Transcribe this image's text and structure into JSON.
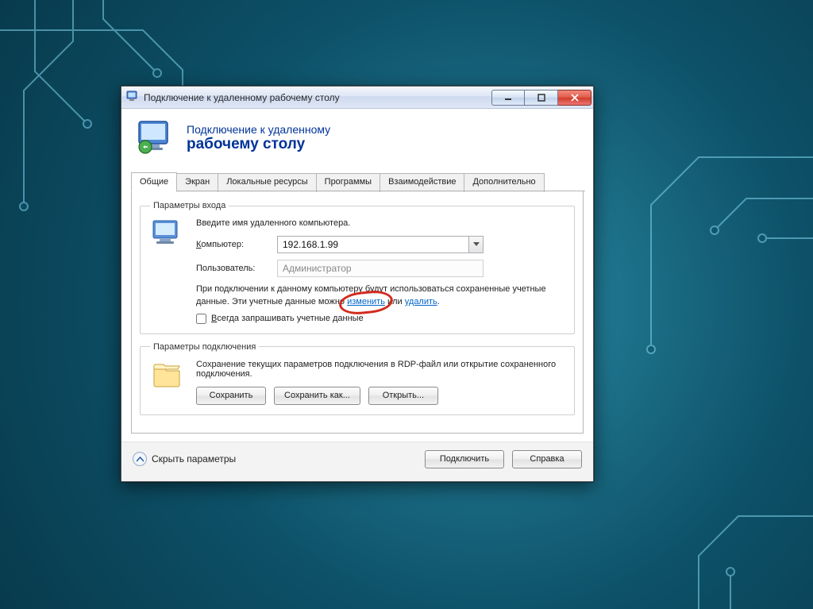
{
  "window": {
    "title": "Подключение к удаленному рабочему столу"
  },
  "header": {
    "line1": "Подключение к удаленному",
    "line2": "рабочему столу"
  },
  "tabs": {
    "general": "Общие",
    "display": "Экран",
    "local_resources": "Локальные ресурсы",
    "programs": "Программы",
    "experience": "Взаимодействие",
    "advanced": "Дополнительно"
  },
  "login_group": {
    "legend": "Параметры входа",
    "intro": "Введите имя удаленного компьютера.",
    "computer_prefix": "К",
    "computer_rest": "омпьютер:",
    "computer_value": "192.168.1.99",
    "user_label": "Пользователь:",
    "user_value": "Администратор",
    "info_prefix": "При подключении к данному компьютеру будут использоваться сохраненные учетные данные. Эти учетные данные можно ",
    "link_change": "изменить",
    "info_between": " или ",
    "link_delete": "удалить",
    "info_suffix": ".",
    "always_ask_prefix": "В",
    "always_ask_rest": "сегда запрашивать учетные данные"
  },
  "conn_group": {
    "legend": "Параметры подключения",
    "desc": "Сохранение текущих параметров подключения в RDP-файл или открытие сохраненного подключения.",
    "save": "Сохранить",
    "save_as": "Сохранить как...",
    "open": "Открыть..."
  },
  "footer": {
    "hide_prefix": "Скрыть ",
    "hide_underline": "п",
    "hide_rest": "араметры",
    "connect": "Подключить",
    "help": "Справка"
  }
}
